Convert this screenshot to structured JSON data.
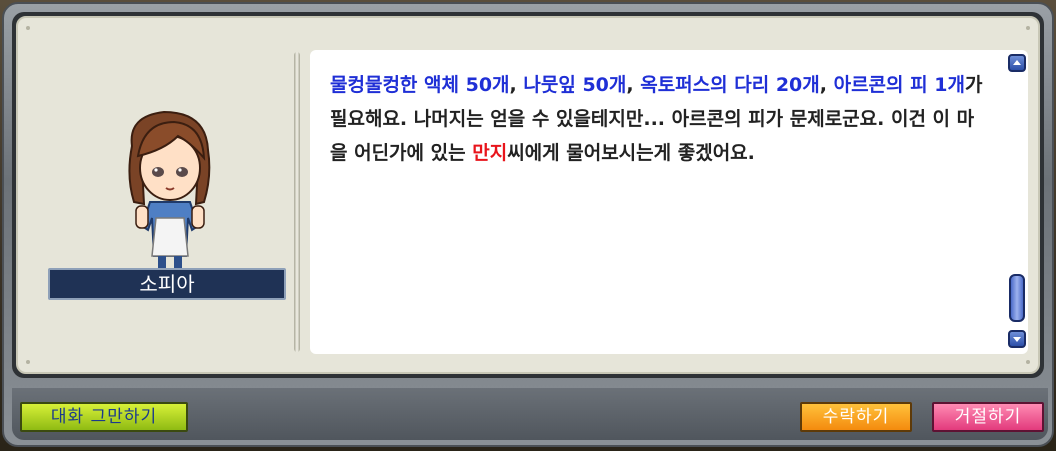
{
  "npc": {
    "name": "소피아"
  },
  "dialog": {
    "segments": [
      {
        "text": "물컹물컹한 액체 ",
        "style": "blue"
      },
      {
        "text": "50",
        "style": "blue-b"
      },
      {
        "text": "개",
        "style": "blue"
      },
      {
        "text": ", ",
        "style": "normal"
      },
      {
        "text": "나뭇잎 ",
        "style": "blue"
      },
      {
        "text": "50",
        "style": "blue-b"
      },
      {
        "text": "개",
        "style": "blue"
      },
      {
        "text": ", ",
        "style": "normal"
      },
      {
        "text": "옥토퍼스의 다리 ",
        "style": "blue"
      },
      {
        "text": "20",
        "style": "blue-b"
      },
      {
        "text": "개",
        "style": "blue"
      },
      {
        "text": ", ",
        "style": "normal"
      },
      {
        "text": "아르콘의 피 ",
        "style": "blue"
      },
      {
        "text": "1",
        "style": "blue-b"
      },
      {
        "text": "개",
        "style": "blue"
      },
      {
        "text": "가 필요해요. 나머지는 얻을 수 있을테지만... 아르콘의 피가 문제로군요. 이건 이 마을 어딘가에 있는 ",
        "style": "normal"
      },
      {
        "text": "만지",
        "style": "red"
      },
      {
        "text": "씨에게 물어보시는게 좋겠어요.",
        "style": "normal"
      }
    ]
  },
  "buttons": {
    "end_chat": "대화 그만하기",
    "accept": "수락하기",
    "decline": "거절하기"
  },
  "icons": {
    "scroll_up": "scroll-up-arrow-icon",
    "scroll_down": "scroll-down-arrow-icon",
    "portrait": "npc-portrait-icon"
  },
  "colors": {
    "highlight_blue": "#1f2fd6",
    "highlight_red": "#e8141b",
    "end_button": "#b6d726",
    "accept_button": "#f8a523",
    "decline_button": "#ef5d97"
  }
}
